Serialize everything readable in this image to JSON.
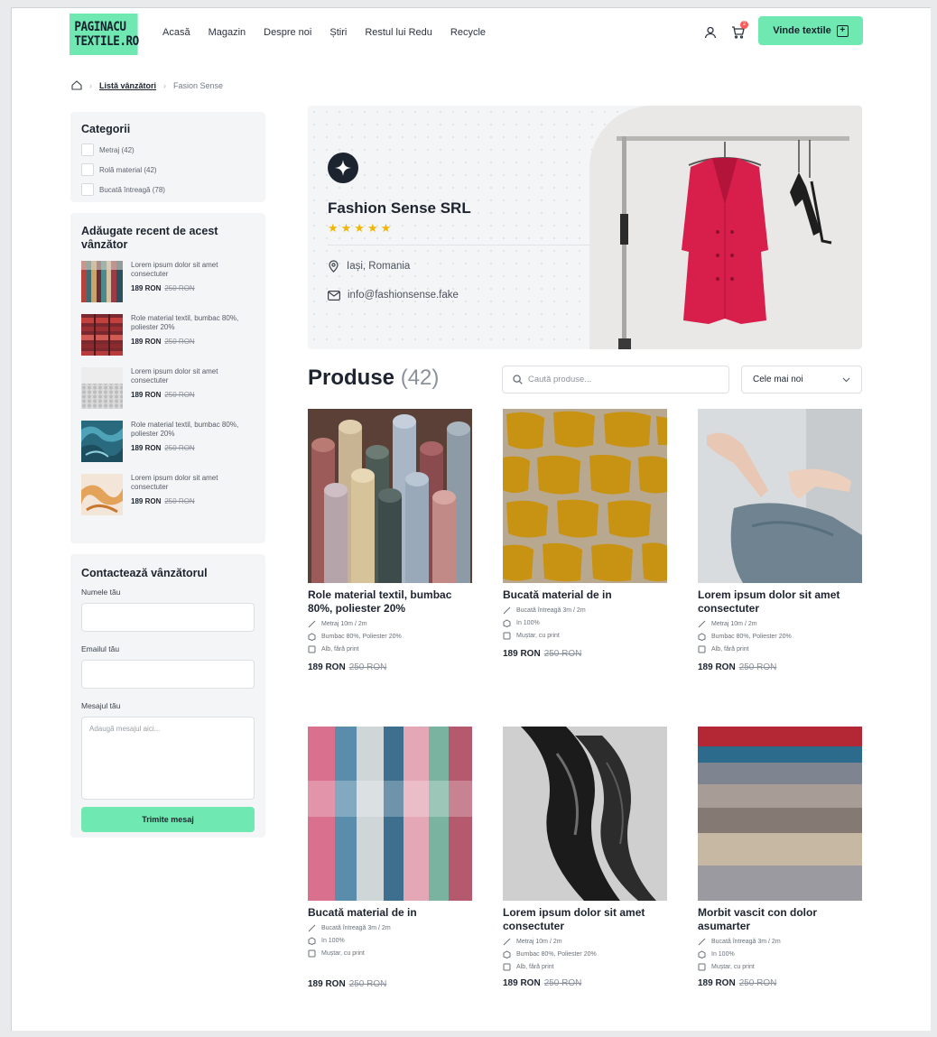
{
  "header": {
    "logo_line1": "PAGINACU",
    "logo_line2": "TEXTILE.RO",
    "nav": [
      "Acasă",
      "Magazin",
      "Despre noi",
      "Știri",
      "Restul lui Redu",
      "Recycle"
    ],
    "cart_count": "2",
    "sell_button": "Vinde textile"
  },
  "breadcrumb": {
    "items": [
      "Listă vânzători",
      "Fasion Sense"
    ]
  },
  "sidebar": {
    "categories_title": "Categorii",
    "categories": [
      "Metraj (42)",
      "Rolă material (42)",
      "Bucată întreagă (78)"
    ],
    "recent_title": "Adăugate recent de acest vânzător",
    "recent": [
      {
        "text": "Lorem ipsum dolor sit amet consectuter",
        "price": "189 RON",
        "old_price": "250 RON"
      },
      {
        "text": "Role material textil, bumbac 80%, poliester 20%",
        "price": "189 RON",
        "old_price": "250 RON"
      },
      {
        "text": "Lorem ipsum dolor sit amet consectuter",
        "price": "189 RON",
        "old_price": "250 RON"
      },
      {
        "text": "Role material textil, bumbac 80%, poliester 20%",
        "price": "189 RON",
        "old_price": "250 RON"
      },
      {
        "text": "Lorem ipsum dolor sit amet consectuter",
        "price": "189 RON",
        "old_price": "250 RON"
      }
    ],
    "contact_title": "Contactează vânzătorul",
    "name_label": "Numele tău",
    "email_label": "Emailul tău",
    "message_label": "Mesajul tău",
    "message_placeholder": "Adaugă mesajul aici...",
    "send_button": "Trimite mesaj"
  },
  "vendor": {
    "name": "Fashion Sense SRL",
    "stars": "★★★★★",
    "location": "Iași, Romania",
    "email": "info@fashionsense.fake"
  },
  "products": {
    "title": "Produse",
    "count": "(42)",
    "search_placeholder": "Caută produse...",
    "sort_value": "Cele mai noi",
    "items": [
      {
        "title": "Role material textil, bumbac 80%, poliester 20%",
        "meta": [
          "Metraj 10m / 2m",
          "Bumbac 80%, Poliester 20%",
          "Alb, fără print"
        ],
        "price": "189 RON",
        "old_price": "250 RON"
      },
      {
        "title": "Bucată material de in",
        "meta": [
          "Bucată întreagă 3m / 2m",
          "In 100%",
          "Muștar, cu print"
        ],
        "price": "189 RON",
        "old_price": "250 RON"
      },
      {
        "title": "Lorem ipsum dolor sit amet consectuter",
        "meta": [
          "Metraj 10m / 2m",
          "Bumbac 80%, Poliester 20%",
          "Alb, fără print"
        ],
        "price": "189 RON",
        "old_price": "250 RON"
      },
      {
        "title": "Bucată material de in",
        "meta": [
          "Bucată întreagă 3m / 2m",
          "In 100%",
          "Muștar, cu print"
        ],
        "price": "189 RON",
        "old_price": "250 RON"
      },
      {
        "title": "Lorem ipsum dolor sit amet consectuter",
        "meta": [
          "Metraj 10m / 2m",
          "Bumbac 80%, Poliester 20%",
          "Alb, fără print"
        ],
        "price": "189 RON",
        "old_price": "250 RON"
      },
      {
        "title": "Morbit vascit con dolor asumarter",
        "meta": [
          "Bucată întreagă 3m / 2m",
          "In 100%",
          "Muștar, cu print"
        ],
        "price": "189 RON",
        "old_price": "250 RON"
      }
    ]
  },
  "colors": {
    "accent": "#6fe8b1",
    "text": "#1d2430",
    "star": "#f2b705",
    "jacket": "#d81e4b"
  }
}
